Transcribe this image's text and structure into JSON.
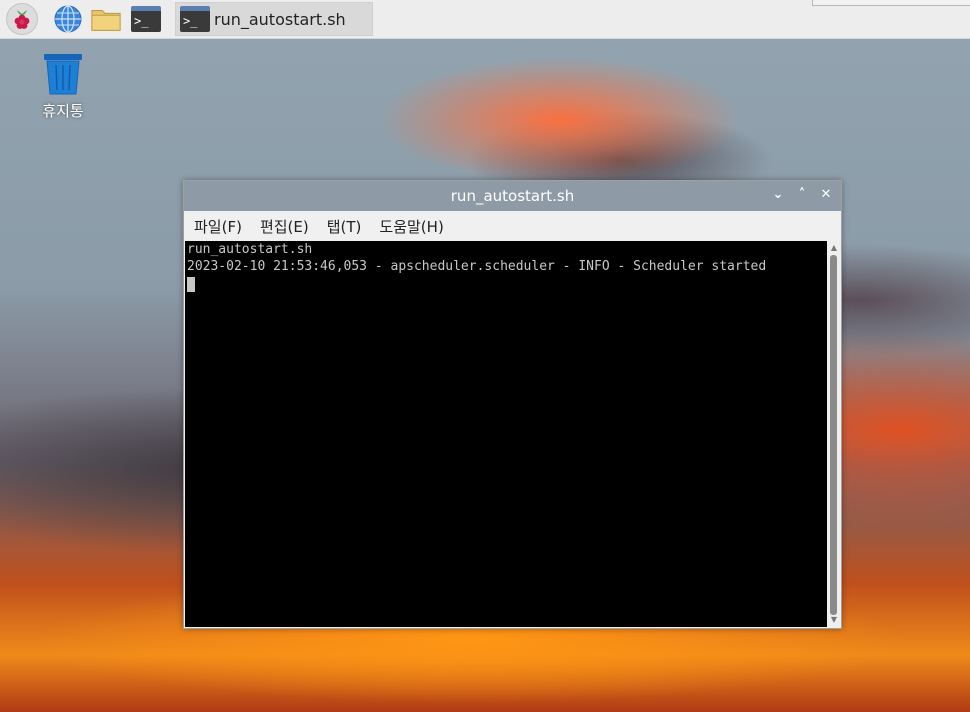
{
  "taskbar": {
    "launchers": [
      {
        "name": "raspberry-menu",
        "icon": "raspberry-icon"
      },
      {
        "name": "web-browser",
        "icon": "globe-icon"
      },
      {
        "name": "file-manager",
        "icon": "folder-icon"
      },
      {
        "name": "terminal",
        "icon": "terminal-icon",
        "glyph": ">_"
      }
    ],
    "task_button": {
      "label": "run_autostart.sh",
      "glyph": ">_"
    }
  },
  "desktop": {
    "trash": {
      "label": "휴지통",
      "icon": "trash-icon",
      "color": "#1e7fd6"
    }
  },
  "window": {
    "title": "run_autostart.sh",
    "controls": {
      "minimize": "⌄",
      "maximize": "˄",
      "close": "✕"
    },
    "menu": [
      "파일(F)",
      "편집(E)",
      "탭(T)",
      "도움말(H)"
    ],
    "terminal_lines": [
      "run_autostart.sh",
      "2023-02-10 21:53:46,053 - apscheduler.scheduler - INFO - Scheduler started"
    ],
    "colors": {
      "titlebar": "#8e9aa5",
      "terminal_bg": "#000000",
      "terminal_fg": "#c8c8c8"
    }
  }
}
